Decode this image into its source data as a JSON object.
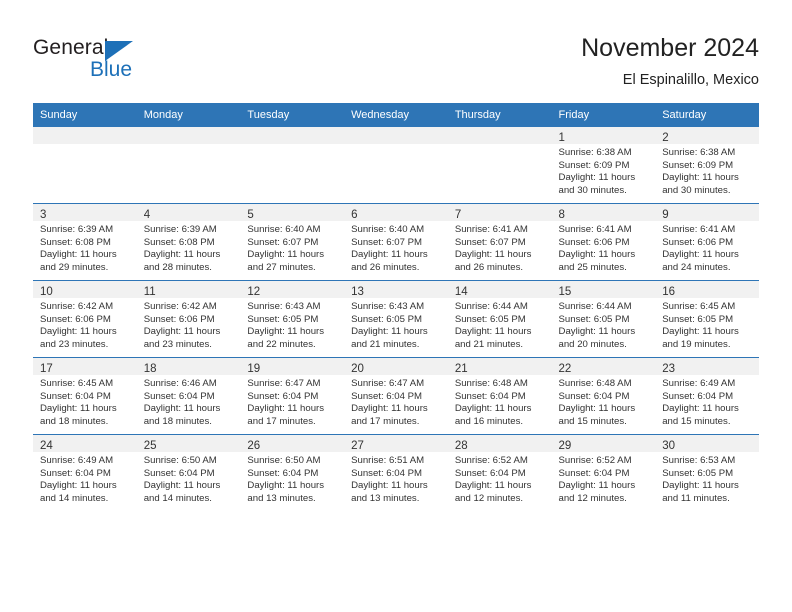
{
  "brand": {
    "name_part1": "General",
    "name_part2": "Blue",
    "accent_color": "#1d70b8"
  },
  "header": {
    "title": "November 2024",
    "subtitle": "El Espinalillo, Mexico"
  },
  "theme": {
    "header_blue": "#2e75b6",
    "daynum_band": "#f1f1f1",
    "text": "#333333"
  },
  "weekday_headers": [
    "Sunday",
    "Monday",
    "Tuesday",
    "Wednesday",
    "Thursday",
    "Friday",
    "Saturday"
  ],
  "weeks": [
    [
      {
        "day": "",
        "lines": []
      },
      {
        "day": "",
        "lines": []
      },
      {
        "day": "",
        "lines": []
      },
      {
        "day": "",
        "lines": []
      },
      {
        "day": "",
        "lines": []
      },
      {
        "day": "1",
        "lines": [
          "Sunrise: 6:38 AM",
          "Sunset: 6:09 PM",
          "Daylight: 11 hours",
          "and 30 minutes."
        ]
      },
      {
        "day": "2",
        "lines": [
          "Sunrise: 6:38 AM",
          "Sunset: 6:09 PM",
          "Daylight: 11 hours",
          "and 30 minutes."
        ]
      }
    ],
    [
      {
        "day": "3",
        "lines": [
          "Sunrise: 6:39 AM",
          "Sunset: 6:08 PM",
          "Daylight: 11 hours",
          "and 29 minutes."
        ]
      },
      {
        "day": "4",
        "lines": [
          "Sunrise: 6:39 AM",
          "Sunset: 6:08 PM",
          "Daylight: 11 hours",
          "and 28 minutes."
        ]
      },
      {
        "day": "5",
        "lines": [
          "Sunrise: 6:40 AM",
          "Sunset: 6:07 PM",
          "Daylight: 11 hours",
          "and 27 minutes."
        ]
      },
      {
        "day": "6",
        "lines": [
          "Sunrise: 6:40 AM",
          "Sunset: 6:07 PM",
          "Daylight: 11 hours",
          "and 26 minutes."
        ]
      },
      {
        "day": "7",
        "lines": [
          "Sunrise: 6:41 AM",
          "Sunset: 6:07 PM",
          "Daylight: 11 hours",
          "and 26 minutes."
        ]
      },
      {
        "day": "8",
        "lines": [
          "Sunrise: 6:41 AM",
          "Sunset: 6:06 PM",
          "Daylight: 11 hours",
          "and 25 minutes."
        ]
      },
      {
        "day": "9",
        "lines": [
          "Sunrise: 6:41 AM",
          "Sunset: 6:06 PM",
          "Daylight: 11 hours",
          "and 24 minutes."
        ]
      }
    ],
    [
      {
        "day": "10",
        "lines": [
          "Sunrise: 6:42 AM",
          "Sunset: 6:06 PM",
          "Daylight: 11 hours",
          "and 23 minutes."
        ]
      },
      {
        "day": "11",
        "lines": [
          "Sunrise: 6:42 AM",
          "Sunset: 6:06 PM",
          "Daylight: 11 hours",
          "and 23 minutes."
        ]
      },
      {
        "day": "12",
        "lines": [
          "Sunrise: 6:43 AM",
          "Sunset: 6:05 PM",
          "Daylight: 11 hours",
          "and 22 minutes."
        ]
      },
      {
        "day": "13",
        "lines": [
          "Sunrise: 6:43 AM",
          "Sunset: 6:05 PM",
          "Daylight: 11 hours",
          "and 21 minutes."
        ]
      },
      {
        "day": "14",
        "lines": [
          "Sunrise: 6:44 AM",
          "Sunset: 6:05 PM",
          "Daylight: 11 hours",
          "and 21 minutes."
        ]
      },
      {
        "day": "15",
        "lines": [
          "Sunrise: 6:44 AM",
          "Sunset: 6:05 PM",
          "Daylight: 11 hours",
          "and 20 minutes."
        ]
      },
      {
        "day": "16",
        "lines": [
          "Sunrise: 6:45 AM",
          "Sunset: 6:05 PM",
          "Daylight: 11 hours",
          "and 19 minutes."
        ]
      }
    ],
    [
      {
        "day": "17",
        "lines": [
          "Sunrise: 6:45 AM",
          "Sunset: 6:04 PM",
          "Daylight: 11 hours",
          "and 18 minutes."
        ]
      },
      {
        "day": "18",
        "lines": [
          "Sunrise: 6:46 AM",
          "Sunset: 6:04 PM",
          "Daylight: 11 hours",
          "and 18 minutes."
        ]
      },
      {
        "day": "19",
        "lines": [
          "Sunrise: 6:47 AM",
          "Sunset: 6:04 PM",
          "Daylight: 11 hours",
          "and 17 minutes."
        ]
      },
      {
        "day": "20",
        "lines": [
          "Sunrise: 6:47 AM",
          "Sunset: 6:04 PM",
          "Daylight: 11 hours",
          "and 17 minutes."
        ]
      },
      {
        "day": "21",
        "lines": [
          "Sunrise: 6:48 AM",
          "Sunset: 6:04 PM",
          "Daylight: 11 hours",
          "and 16 minutes."
        ]
      },
      {
        "day": "22",
        "lines": [
          "Sunrise: 6:48 AM",
          "Sunset: 6:04 PM",
          "Daylight: 11 hours",
          "and 15 minutes."
        ]
      },
      {
        "day": "23",
        "lines": [
          "Sunrise: 6:49 AM",
          "Sunset: 6:04 PM",
          "Daylight: 11 hours",
          "and 15 minutes."
        ]
      }
    ],
    [
      {
        "day": "24",
        "lines": [
          "Sunrise: 6:49 AM",
          "Sunset: 6:04 PM",
          "Daylight: 11 hours",
          "and 14 minutes."
        ]
      },
      {
        "day": "25",
        "lines": [
          "Sunrise: 6:50 AM",
          "Sunset: 6:04 PM",
          "Daylight: 11 hours",
          "and 14 minutes."
        ]
      },
      {
        "day": "26",
        "lines": [
          "Sunrise: 6:50 AM",
          "Sunset: 6:04 PM",
          "Daylight: 11 hours",
          "and 13 minutes."
        ]
      },
      {
        "day": "27",
        "lines": [
          "Sunrise: 6:51 AM",
          "Sunset: 6:04 PM",
          "Daylight: 11 hours",
          "and 13 minutes."
        ]
      },
      {
        "day": "28",
        "lines": [
          "Sunrise: 6:52 AM",
          "Sunset: 6:04 PM",
          "Daylight: 11 hours",
          "and 12 minutes."
        ]
      },
      {
        "day": "29",
        "lines": [
          "Sunrise: 6:52 AM",
          "Sunset: 6:04 PM",
          "Daylight: 11 hours",
          "and 12 minutes."
        ]
      },
      {
        "day": "30",
        "lines": [
          "Sunrise: 6:53 AM",
          "Sunset: 6:05 PM",
          "Daylight: 11 hours",
          "and 11 minutes."
        ]
      }
    ]
  ]
}
